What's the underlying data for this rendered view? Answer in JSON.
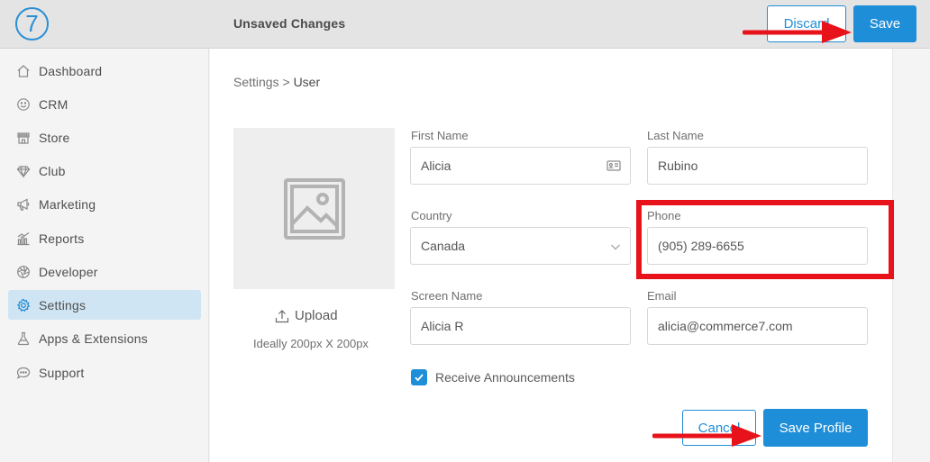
{
  "app": {
    "logo_glyph": "7",
    "top_title": "Unsaved Changes",
    "discard_label": "Discard",
    "save_label": "Save",
    "accent_color": "#1f8ed8"
  },
  "sidebar": {
    "items": [
      {
        "label": "Dashboard",
        "icon": "home-icon",
        "active": false
      },
      {
        "label": "CRM",
        "icon": "smiley-icon",
        "active": false
      },
      {
        "label": "Store",
        "icon": "storefront-icon",
        "active": false
      },
      {
        "label": "Club",
        "icon": "diamond-icon",
        "active": false
      },
      {
        "label": "Marketing",
        "icon": "megaphone-icon",
        "active": false
      },
      {
        "label": "Reports",
        "icon": "bar-chart-icon",
        "active": false
      },
      {
        "label": "Developer",
        "icon": "aperture-icon",
        "active": false
      },
      {
        "label": "Settings",
        "icon": "gear-icon",
        "active": true
      },
      {
        "label": "Apps & Extensions",
        "icon": "flask-icon",
        "active": false
      },
      {
        "label": "Support",
        "icon": "chat-bubble-icon",
        "active": false
      }
    ]
  },
  "breadcrumb": {
    "parent": "Settings",
    "separator": ">",
    "current": "User"
  },
  "profile_image": {
    "upload_label": "Upload",
    "hint": "Ideally 200px X 200px"
  },
  "form": {
    "first_name": {
      "label": "First Name",
      "value": "Alicia"
    },
    "last_name": {
      "label": "Last Name",
      "value": "Rubino"
    },
    "country": {
      "label": "Country",
      "value": "Canada"
    },
    "phone": {
      "label": "Phone",
      "value": "(905) 289-6655"
    },
    "screen_name": {
      "label": "Screen Name",
      "value": "Alicia R"
    },
    "email": {
      "label": "Email",
      "value": "alicia@commerce7.com"
    },
    "receive_announcements": {
      "label": "Receive Announcements",
      "checked": true
    }
  },
  "actions": {
    "cancel_label": "Cancel",
    "save_profile_label": "Save Profile"
  },
  "annotation_color": "#e8131a"
}
